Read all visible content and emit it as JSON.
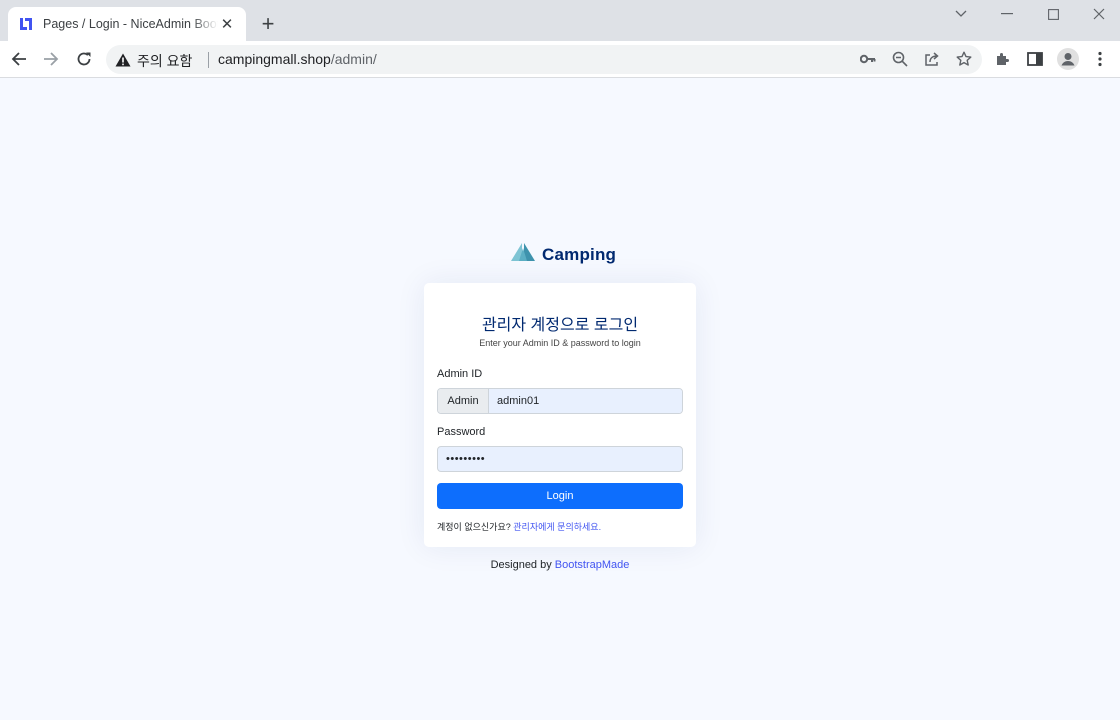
{
  "browser": {
    "tab": {
      "title": "Pages / Login - NiceAdmin Bootstrap Template"
    },
    "address": {
      "security_label": "주의 요함",
      "url_host": "campingmall.shop",
      "url_path": "/admin/"
    }
  },
  "page": {
    "brand": {
      "name": "Camping"
    },
    "card": {
      "title": "관리자 계정으로 로그인",
      "subtitle": "Enter your Admin ID & password to login",
      "admin_id_label": "Admin ID",
      "admin_id_prefix": "Admin",
      "admin_id_value": "admin01",
      "password_label": "Password",
      "password_value": "•••••••••",
      "login_button": "Login",
      "footer_text": "계정이 없으신가요?",
      "footer_link": "관리자에게 문의하세요."
    },
    "credits": {
      "text": "Designed by",
      "link": "BootstrapMade"
    }
  },
  "colors": {
    "page_bg": "#f6f9ff",
    "brand": "#012970",
    "primary": "#0d6efd",
    "link": "#4154f1",
    "autofill": "#e8f0fe"
  }
}
